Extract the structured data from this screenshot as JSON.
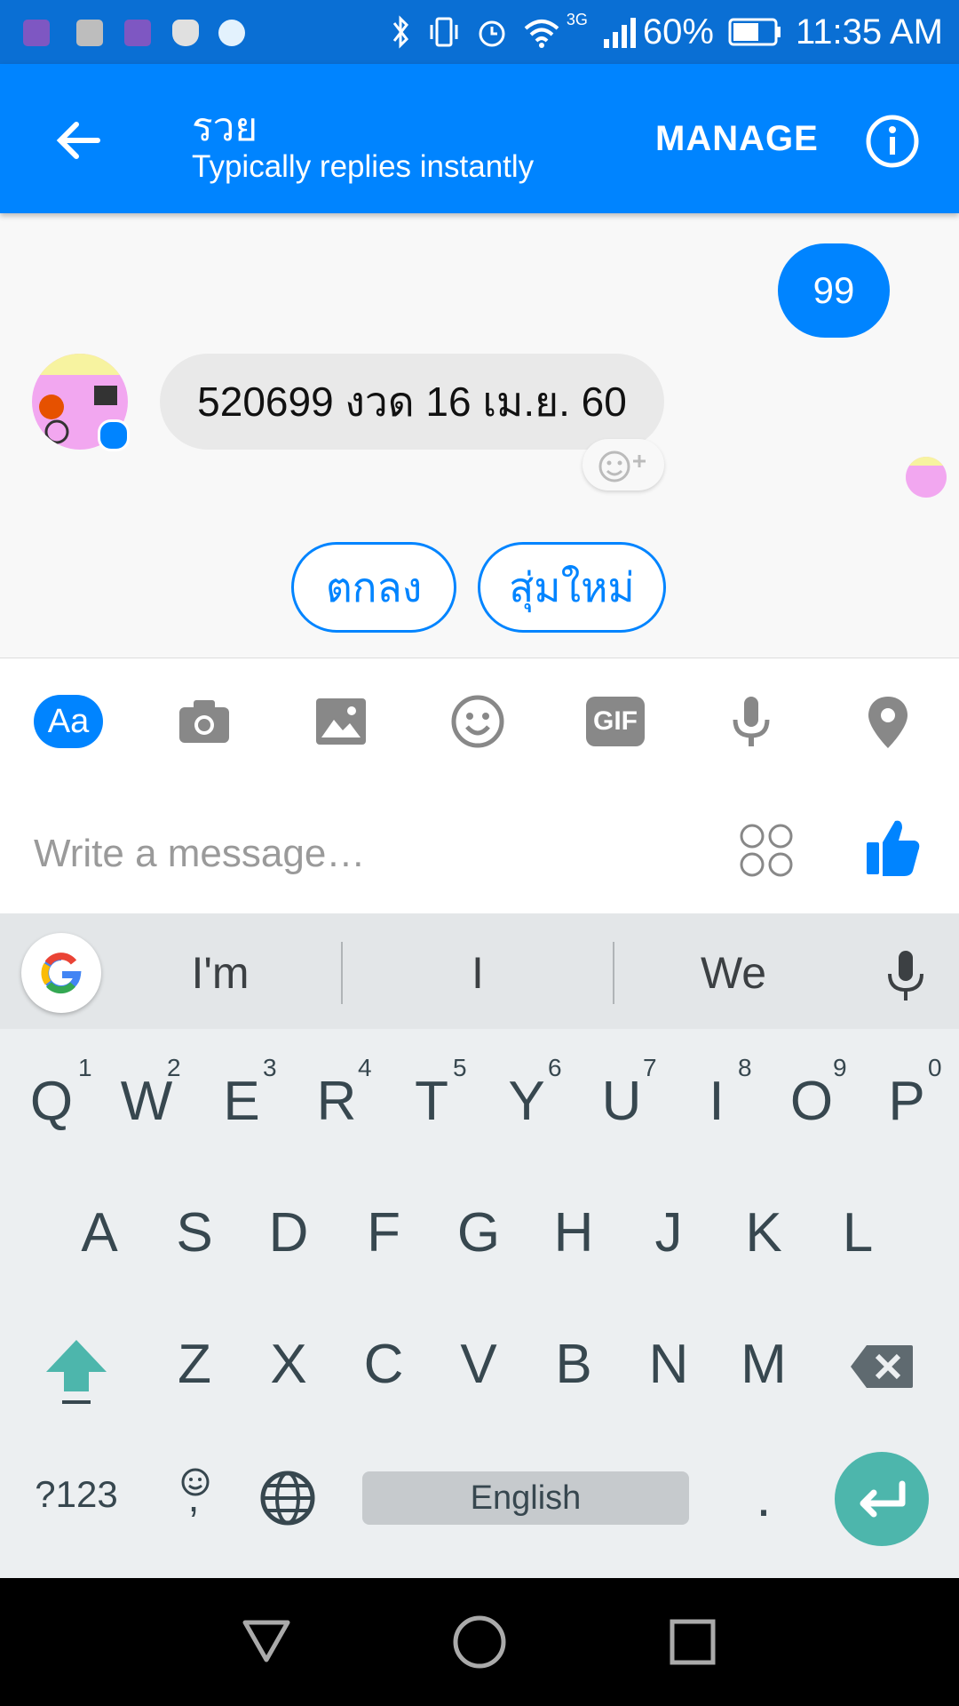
{
  "status_bar": {
    "battery": "60%",
    "network": "3G",
    "time": "11:35 AM"
  },
  "header": {
    "title": "รวย",
    "subtitle": "Typically replies instantly",
    "manage_label": "MANAGE"
  },
  "chat": {
    "sent_message": "99",
    "received_message": "520699 งวด 16 เม.ย. 60",
    "quick_replies": [
      "ตกลง",
      "สุ่มใหม่"
    ]
  },
  "composer": {
    "aa_label": "Aa",
    "gif_label": "GIF",
    "placeholder": "Write a message…"
  },
  "keyboard": {
    "suggestions": [
      "I'm",
      "I",
      "We"
    ],
    "row1": [
      "Q",
      "W",
      "E",
      "R",
      "T",
      "Y",
      "U",
      "I",
      "O",
      "P"
    ],
    "row1_hints": [
      "1",
      "2",
      "3",
      "4",
      "5",
      "6",
      "7",
      "8",
      "9",
      "0"
    ],
    "row2": [
      "A",
      "S",
      "D",
      "F",
      "G",
      "H",
      "J",
      "K",
      "L"
    ],
    "row3": [
      "Z",
      "X",
      "C",
      "V",
      "B",
      "N",
      "M"
    ],
    "symbols_label": "?123",
    "comma_label": ",",
    "space_label": "English",
    "period_label": "."
  },
  "colors": {
    "brand_blue": "#0084ff",
    "status_bar": "#0a6fd4",
    "enter_key": "#4db6ac"
  }
}
